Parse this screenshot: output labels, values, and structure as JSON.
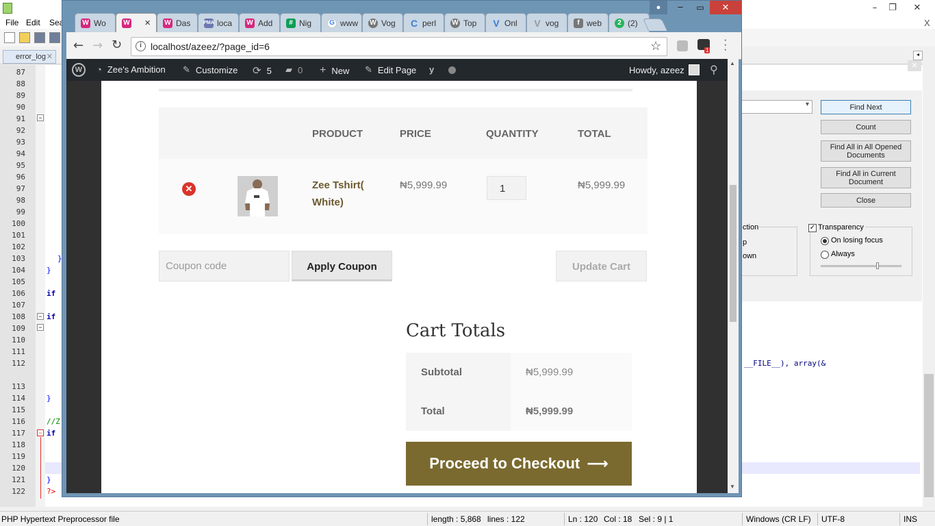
{
  "npp": {
    "menu": [
      "File",
      "Edit",
      "Sea"
    ],
    "tab_label": "error_log",
    "line_numbers": [
      "87",
      "88",
      "89",
      "90",
      "91",
      "92",
      "93",
      "94",
      "95",
      "96",
      "97",
      "98",
      "99",
      "100",
      "101",
      "102",
      "103",
      "104",
      "105",
      "106",
      "107",
      "108",
      "109",
      "110",
      "111",
      "112",
      "113",
      "114",
      "115",
      "116",
      "117",
      "118",
      "119",
      "120",
      "121",
      "122"
    ],
    "code": {
      "l103": "}",
      "l104": "}",
      "l106": "if",
      "l108": "if",
      "l114": "}",
      "l116": "//Z",
      "l117": "if",
      "l121": "}",
      "l122": "?>",
      "right_fragment": "__FILE__), array(&"
    },
    "find_dialog": {
      "find_next": "Find Next",
      "count": "Count",
      "find_all_opened": "Find All in All Opened Documents",
      "find_all_current": "Find All in Current Document",
      "close": "Close",
      "direction_fragments": [
        "ction",
        "p",
        "own"
      ],
      "transparency_label": "Transparency",
      "on_losing_focus": "On losing focus",
      "always": "Always"
    },
    "status": {
      "file_type": "PHP Hypertext Preprocessor file",
      "length": "length : 5,868",
      "lines": "lines : 122",
      "ln": "Ln : 120",
      "col": "Col : 18",
      "sel": "Sel : 9 | 1",
      "eol": "Windows (CR LF)",
      "encoding": "UTF-8",
      "mode": "INS"
    }
  },
  "browser": {
    "tabs": [
      {
        "label": "Wo",
        "icon": "wordpress-admin-icon",
        "color": "#d6287f"
      },
      {
        "label": "",
        "icon": "wordpress-admin-icon",
        "color": "#d6287f"
      },
      {
        "label": "Das",
        "icon": "wordpress-admin-icon",
        "color": "#d6287f"
      },
      {
        "label": "loca",
        "icon": "phpmyadmin-icon",
        "color": "#6c78af"
      },
      {
        "label": "Add",
        "icon": "wordpress-admin-icon",
        "color": "#d6287f"
      },
      {
        "label": "Nig",
        "icon": "spreadsheet-icon",
        "color": "#0f9d58"
      },
      {
        "label": "www",
        "icon": "google-icon",
        "color": "#4285f4"
      },
      {
        "label": "Vog",
        "icon": "wordpress-icon",
        "color": "#777777"
      },
      {
        "label": "perl",
        "icon": "c-icon",
        "color": "#3b7dd8"
      },
      {
        "label": "Top",
        "icon": "wordpress-icon",
        "color": "#777777"
      },
      {
        "label": "Onl",
        "icon": "v-icon",
        "color": "#3b7dd8"
      },
      {
        "label": "vog",
        "icon": "v-icon",
        "color": "#999999"
      },
      {
        "label": "web",
        "icon": "facebook-icon",
        "color": "#777777"
      },
      {
        "label": "(2)",
        "icon": "whatsapp-icon",
        "color": "#25b35c"
      }
    ],
    "close_tab_glyph": "×",
    "url": "localhost/azeez/?page_id=6",
    "extension_badge": "1",
    "wp_admin_bar": {
      "site_name": "Zee's Ambition",
      "customize": "Customize",
      "updates_count": "5",
      "comments_count": "0",
      "new": "New",
      "edit_page": "Edit Page",
      "greeting": "Howdy, azeez"
    }
  },
  "cart": {
    "headers": {
      "product": "PRODUCT",
      "price": "PRICE",
      "quantity": "QUANTITY",
      "total": "TOTAL"
    },
    "items": [
      {
        "name_line1": "Zee Tshirt(",
        "name_line2": "White)",
        "price": "₦5,999.99",
        "quantity": "1",
        "total": "₦5,999.99"
      }
    ],
    "coupon_placeholder": "Coupon code",
    "apply_coupon": "Apply Coupon",
    "update_cart": "Update Cart",
    "totals": {
      "heading": "Cart Totals",
      "subtotal_label": "Subtotal",
      "subtotal_value": "₦5,999.99",
      "total_label": "Total",
      "total_value": "₦5,999.99"
    },
    "checkout_button": "Proceed to Checkout",
    "checkout_arrow": "⟶",
    "colors": {
      "accent": "#7a6a2f",
      "link": "#6b5a2e",
      "remove": "#d9342b"
    }
  }
}
